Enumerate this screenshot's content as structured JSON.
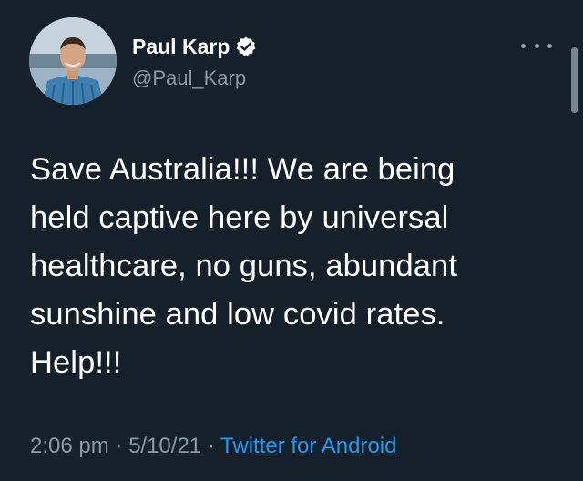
{
  "author": {
    "display_name": "Paul Karp",
    "handle": "@Paul_Karp",
    "verified": true
  },
  "tweet": {
    "lines": [
      "Save Australia!!! We are being",
      "held captive here by universal",
      "healthcare, no guns, abundant",
      "sunshine and low covid rates.",
      "Help!!!"
    ]
  },
  "meta": {
    "time": "2:06 pm",
    "separator": "·",
    "date": "5/10/21",
    "source": "Twitter for Android"
  },
  "icons": {
    "verified": "verified-badge-icon",
    "more": "more-options-icon"
  },
  "colors": {
    "background": "#15202b",
    "text": "#ffffff",
    "secondary": "#8b98a5",
    "link": "#1d9bf0"
  }
}
